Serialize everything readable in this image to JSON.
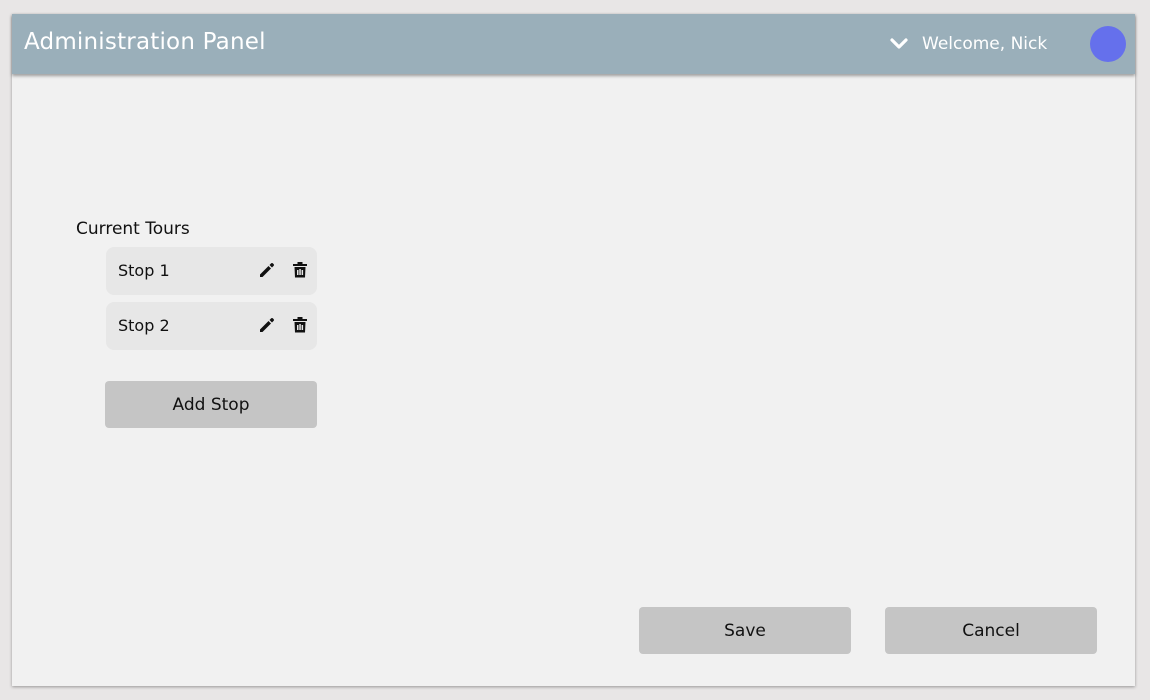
{
  "header": {
    "title": "Administration Panel",
    "welcome_text": "Welcome, Nick",
    "background_color": "#9aafba",
    "avatar_color": "#6570ec"
  },
  "tours": {
    "section_label": "Current Tours",
    "stops": [
      {
        "label": "Stop 1"
      },
      {
        "label": "Stop 2"
      }
    ],
    "add_stop_label": "Add Stop"
  },
  "actions": {
    "save_label": "Save",
    "cancel_label": "Cancel"
  },
  "icons": {
    "user_menu": "chevron-down-icon",
    "edit": "pencil-icon",
    "delete": "trash-icon"
  }
}
